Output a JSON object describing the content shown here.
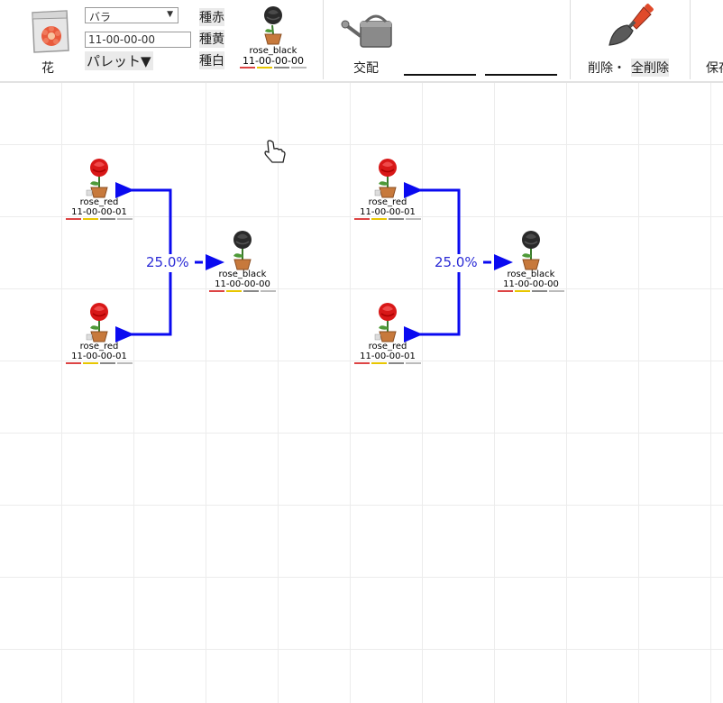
{
  "toolbar": {
    "flower_label": "花",
    "species_select": "バラ",
    "gene_input": "11-00-00-00",
    "palette_label": "パレット▼",
    "seed_buttons": [
      "種赤",
      "種黄",
      "種白"
    ],
    "preview": {
      "name": "rose_black",
      "gene": "11-00-00-00"
    },
    "breed_label": "交配",
    "delete_label": "削除・",
    "delete_all_label": "全削除",
    "save_label": "保存"
  },
  "colors": {
    "connector": "#0a0af0",
    "percent_text": "#2b2bd6",
    "rose_red": "#d81818",
    "rose_black": "#2a2a2a",
    "gene_bar_red": "#d44",
    "gene_bar_yellow": "#e8c600",
    "gene_bar_white": "#bbbbbb"
  },
  "canvas": {
    "crosses": [
      {
        "parent_a": {
          "name": "rose_red",
          "gene": "11-00-00-01"
        },
        "parent_b": {
          "name": "rose_red",
          "gene": "11-00-00-01"
        },
        "percent": "25.0%",
        "child": {
          "name": "rose_black",
          "gene": "11-00-00-00"
        }
      },
      {
        "parent_a": {
          "name": "rose_red",
          "gene": "11-00-00-01"
        },
        "parent_b": {
          "name": "rose_red",
          "gene": "11-00-00-01"
        },
        "percent": "25.0%",
        "child": {
          "name": "rose_black",
          "gene": "11-00-00-00"
        }
      }
    ]
  }
}
